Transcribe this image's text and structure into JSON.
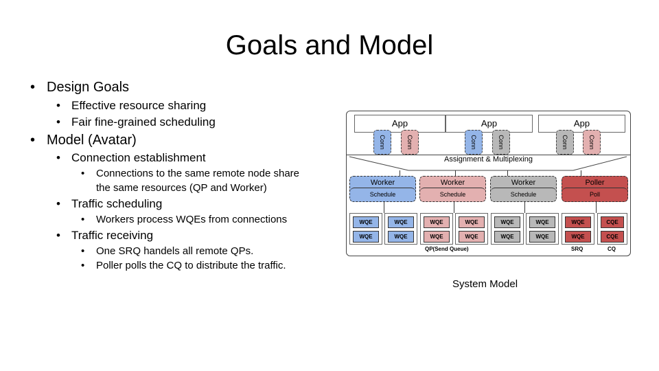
{
  "slide": {
    "title": "Goals and Model",
    "bullets": [
      {
        "text": "Design Goals",
        "level": 1
      },
      {
        "text": "Effective resource sharing",
        "level": 2
      },
      {
        "text": "Fair fine-grained scheduling",
        "level": 2
      },
      {
        "text": "Model (Avatar)",
        "level": 1
      },
      {
        "text": "Connection establishment",
        "level": 2
      },
      {
        "text": "Connections to the same remote node share",
        "level": 3
      },
      {
        "text": "the same resources (QP and Worker)",
        "level": 3
      },
      {
        "text": "Traffic scheduling",
        "level": 2
      },
      {
        "text": "Workers process WQEs from connections",
        "level": 3
      },
      {
        "text": "Traffic receiving",
        "level": 2
      },
      {
        "text": "One SRQ handels all remote QPs.",
        "level": 3
      },
      {
        "text": "Poller polls the CQ to distribute the traffic.",
        "level": 3
      }
    ],
    "bullet_glyph": "•",
    "caption": "System Model"
  },
  "diagram": {
    "apps": [
      "App",
      "App",
      "App"
    ],
    "conn_label": "Conn",
    "assignment_label": "Assignment & Multiplexing",
    "workers": [
      {
        "title": "Worker",
        "sub": "Schedule",
        "color": "#94b5e8"
      },
      {
        "title": "Worker",
        "sub": "Schedule",
        "color": "#e3b0b0"
      },
      {
        "title": "Worker",
        "sub": "Schedule",
        "color": "#b8b8b8"
      },
      {
        "title": "Poller",
        "sub": "Poll",
        "color": "#c4504f"
      }
    ],
    "wqe_label": "WQE",
    "cqe_label": "CQE",
    "qp_label": "QP(Send Queue)",
    "srq_label": "SRQ",
    "cq_label": "CQ"
  }
}
